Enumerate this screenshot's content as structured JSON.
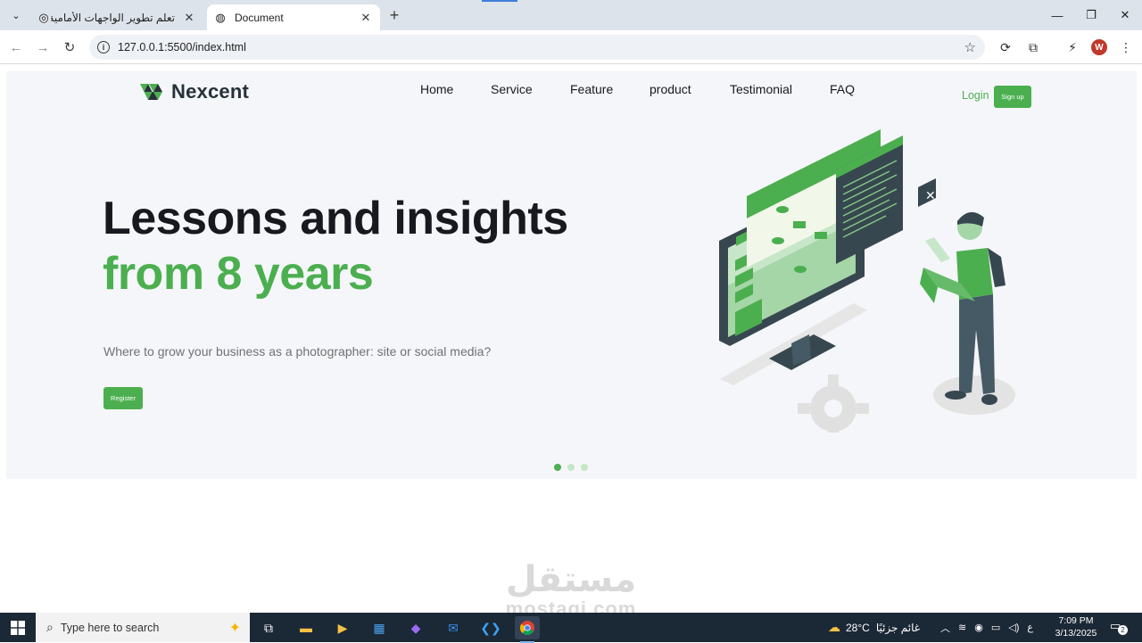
{
  "browser": {
    "tabs": [
      {
        "title": "تعلم تطوير الواجهات الأمامية",
        "active": false
      },
      {
        "title": "Document",
        "active": true
      }
    ],
    "url": "127.0.0.1:5500/index.html",
    "profile_initial": "W"
  },
  "site": {
    "logo": "Nexcent",
    "nav": [
      "Home",
      "Service",
      "Feature",
      "product",
      "Testimonial",
      "FAQ"
    ],
    "login": "Login",
    "signup": "Sign up",
    "hero": {
      "line1": "Lessons and insights",
      "line2": "from 8 years",
      "subtitle": "Where to grow your business as a photographer: site or social media?",
      "button": "Register"
    },
    "slider": {
      "count": 3,
      "active": 0
    }
  },
  "watermark": {
    "ar": "مستقل",
    "en": "mostaqi.com"
  },
  "taskbar": {
    "search_placeholder": "Type here to search",
    "weather": "28°C",
    "weather_desc": "غائم جزئيًا",
    "lang": "ع",
    "time": "7:09 PM",
    "date": "3/13/2025",
    "notifications": "2"
  },
  "colors": {
    "brand_green": "#4caf4f",
    "heading": "#18191f",
    "hero_bg": "#f5f6fa",
    "taskbar": "#1b2836"
  }
}
